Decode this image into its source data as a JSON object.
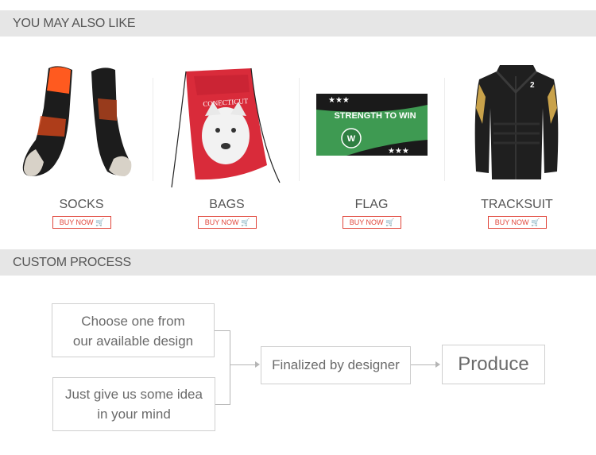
{
  "sections": {
    "also_like": {
      "title": "YOU MAY ALSO LIKE"
    },
    "custom_process": {
      "title": "CUSTOM PROCESS"
    }
  },
  "products": [
    {
      "name": "SOCKS",
      "buy_label": "BUY NOW 🛒"
    },
    {
      "name": "BAGS",
      "buy_label": "BUY NOW 🛒"
    },
    {
      "name": "FLAG",
      "buy_label": "BUY NOW 🛒"
    },
    {
      "name": "TRACKSUIT",
      "buy_label": "BUY NOW 🛒"
    }
  ],
  "artwork": {
    "bag_text": "CONECTICUT",
    "flag_text": "STRENGTH TO WIN",
    "flag_badge": "W",
    "jacket_logo": "2"
  },
  "process": {
    "step_a": {
      "line1": "Choose one from",
      "line2": "our available design"
    },
    "step_b": {
      "line1": "Just give us some idea",
      "line2": "in your mind"
    },
    "step_c": "Finalized by designer",
    "step_d": "Produce"
  },
  "colors": {
    "buy_accent": "#e0453a",
    "header_bg": "#e6e6e6",
    "flag_green": "#3e9a52",
    "bag_red": "#d92b3a",
    "sock_orange": "#ff5a1f"
  }
}
